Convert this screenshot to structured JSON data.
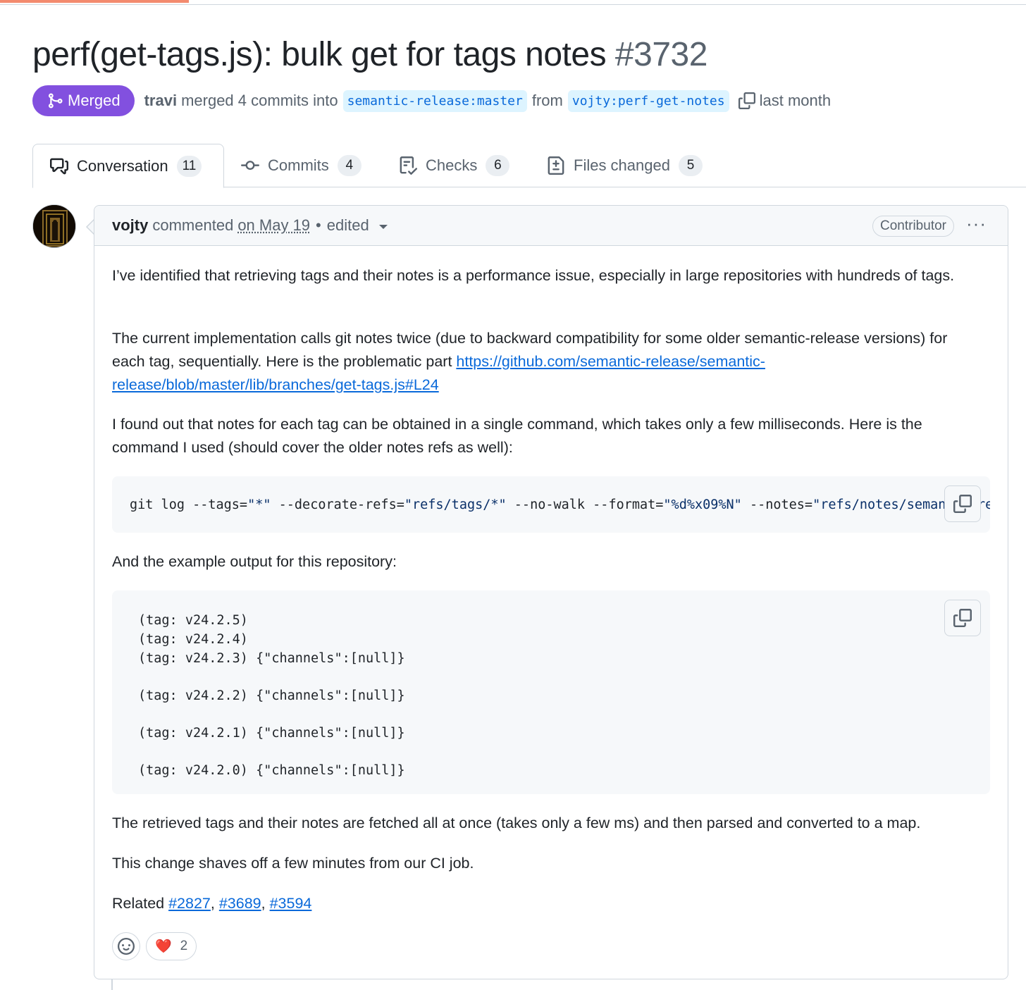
{
  "pr": {
    "title": "perf(get-tags.js): bulk get for tags notes",
    "number": "#3732",
    "status_label": "Merged",
    "merged_by": "travi",
    "merge_text": "merged 4 commits into",
    "base_branch": "semantic-release:master",
    "from_text": "from",
    "head_branch": "vojty:perf-get-notes",
    "time_ago": "last month"
  },
  "tabs": [
    {
      "label": "Conversation",
      "count": "11",
      "icon": "conversation-icon"
    },
    {
      "label": "Commits",
      "count": "4",
      "icon": "commit-icon"
    },
    {
      "label": "Checks",
      "count": "6",
      "icon": "checklist-icon"
    },
    {
      "label": "Files changed",
      "count": "5",
      "icon": "file-diff-icon"
    }
  ],
  "comment": {
    "author": "vojty",
    "action": "commented",
    "date": "on May 19",
    "edited": "edited",
    "role_badge": "Contributor",
    "menu": "···",
    "p1": "I’ve identified that retrieving tags and their notes is a performance issue, especially in large repositories with hundreds of tags.",
    "p2_prefix": "The current implementation calls git notes twice (due to backward compatibility for some older semantic-release versions) for each tag, sequentially. Here is the problematic part ",
    "p2_link": "https://github.com/semantic-release/semantic-release/blob/master/lib/branches/get-tags.js#L24",
    "p3": "I found out that notes for each tag can be obtained in a single command, which takes only a few milliseconds. Here is the command I used (should cover the older notes refs as well):",
    "command": {
      "cmd": "git log --tags=",
      "tags_val": "\"*\"",
      "decorate": " --decorate-refs=",
      "decorate_val": "\"refs/tags/*\"",
      "nowalk": " --no-walk --format=",
      "format_val": "\"%d%x09%N\"",
      "notes": " --notes=",
      "notes_val": "\"refs/notes/semantic-release*\""
    },
    "p4": "And the example output for this repository:",
    "output_lines": [
      "(tag: v24.2.5)",
      "(tag: v24.2.4)",
      "(tag: v24.2.3) {\"channels\":[null]}",
      "(tag: v24.2.2) {\"channels\":[null]}",
      "(tag: v24.2.1) {\"channels\":[null]}",
      "(tag: v24.2.0) {\"channels\":[null]}"
    ],
    "p5": "The retrieved tags and their notes are fetched all at once (takes only a few ms) and then parsed and converted to a map.",
    "p6": "This change shaves off a few minutes from our CI job.",
    "related_label": "Related ",
    "related_links": [
      "#2827",
      "#3689",
      "#3594"
    ],
    "related_sep": ", ",
    "reactions": [
      {
        "emoji": "❤️",
        "count": "2"
      }
    ]
  },
  "colors": {
    "merged": "#8250df",
    "link": "#0969da",
    "branch_bg": "#ddf4ff",
    "muted": "#59636e",
    "progress": "#f38b6f"
  }
}
